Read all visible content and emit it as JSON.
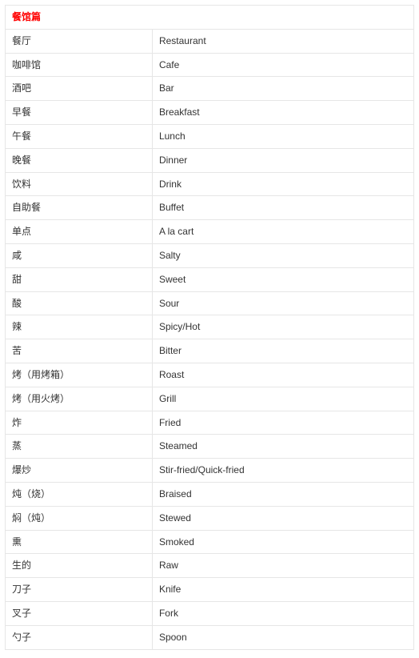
{
  "header": {
    "title": "餐馆篇"
  },
  "rows": [
    {
      "zh": "餐厅",
      "en": "Restaurant"
    },
    {
      "zh": "咖啡馆",
      "en": "Cafe"
    },
    {
      "zh": "酒吧",
      "en": "Bar"
    },
    {
      "zh": "早餐",
      "en": "Breakfast"
    },
    {
      "zh": "午餐",
      "en": "Lunch"
    },
    {
      "zh": "晚餐",
      "en": "Dinner"
    },
    {
      "zh": "饮料",
      "en": "Drink"
    },
    {
      "zh": "自助餐",
      "en": "Buffet"
    },
    {
      "zh": "单点",
      "en": "A la cart"
    },
    {
      "zh": "咸",
      "en": "Salty"
    },
    {
      "zh": "甜",
      "en": "Sweet"
    },
    {
      "zh": "酸",
      "en": "Sour"
    },
    {
      "zh": "辣",
      "en": "Spicy/Hot"
    },
    {
      "zh": "苦",
      "en": "Bitter"
    },
    {
      "zh": "烤（用烤箱）",
      "en": "Roast"
    },
    {
      "zh": "烤（用火烤）",
      "en": "Grill"
    },
    {
      "zh": "炸",
      "en": "Fried"
    },
    {
      "zh": "蒸",
      "en": "Steamed"
    },
    {
      "zh": "爆炒",
      "en": "Stir-fried/Quick-fried"
    },
    {
      "zh": "炖（烧）",
      "en": "Braised"
    },
    {
      "zh": "焖（炖）",
      "en": "Stewed"
    },
    {
      "zh": "熏",
      "en": "Smoked"
    },
    {
      "zh": "生的",
      "en": "Raw"
    },
    {
      "zh": "刀子",
      "en": "Knife"
    },
    {
      "zh": "叉子",
      "en": "Fork"
    },
    {
      "zh": "勺子",
      "en": "Spoon"
    }
  ]
}
